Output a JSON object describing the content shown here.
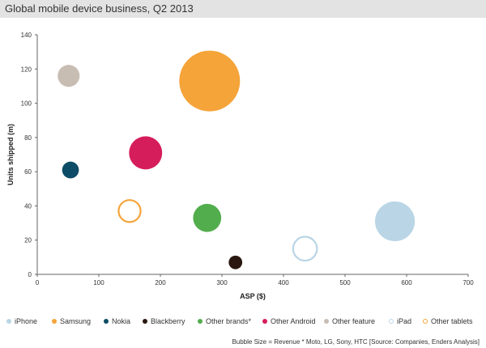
{
  "title": "Global mobile device business, Q2 2013",
  "footnote": "Bubble Size = Revenue * Moto, LG, Sony, HTC [Source: Companies, Enders Analysis]",
  "chart_data": {
    "type": "scatter",
    "subtype": "bubble",
    "xlabel": "ASP ($)",
    "ylabel": "Units shipped (m)",
    "xlim": [
      0,
      700
    ],
    "ylim": [
      0,
      140
    ],
    "x_ticks": [
      "0",
      "100",
      "200",
      "300",
      "400",
      "500",
      "600",
      "700"
    ],
    "y_ticks": [
      "0",
      "20",
      "40",
      "60",
      "80",
      "100",
      "120",
      "140"
    ],
    "grid": false,
    "legend_position": "bottom",
    "series": [
      {
        "name": "iPhone",
        "x": 581,
        "y": 31,
        "size": 18,
        "color": "#b9d5e6",
        "filled": true
      },
      {
        "name": "Samsung",
        "x": 280,
        "y": 113,
        "size": 42,
        "color": "#f5a43a",
        "filled": true
      },
      {
        "name": "Nokia",
        "x": 54,
        "y": 61,
        "size": 3.2,
        "color": "#0d4c66",
        "filled": true
      },
      {
        "name": "Blackberry",
        "x": 322,
        "y": 7,
        "size": 2.1,
        "color": "#2a1810",
        "filled": true
      },
      {
        "name": "Other brands*",
        "x": 276,
        "y": 33,
        "size": 9,
        "color": "#52ad4d",
        "filled": true
      },
      {
        "name": "Other Android",
        "x": 176,
        "y": 71,
        "size": 12.5,
        "color": "#d61d5c",
        "filled": true
      },
      {
        "name": "Other feature",
        "x": 51,
        "y": 116,
        "size": 5.5,
        "color": "#c8bdb2",
        "filled": true
      },
      {
        "name": "iPad",
        "x": 435,
        "y": 15,
        "size": 6.5,
        "color": "#b9d5e6",
        "filled": false
      },
      {
        "name": "Other tablets",
        "x": 150,
        "y": 37,
        "size": 5.5,
        "color": "#f5a43a",
        "filled": false
      }
    ]
  }
}
